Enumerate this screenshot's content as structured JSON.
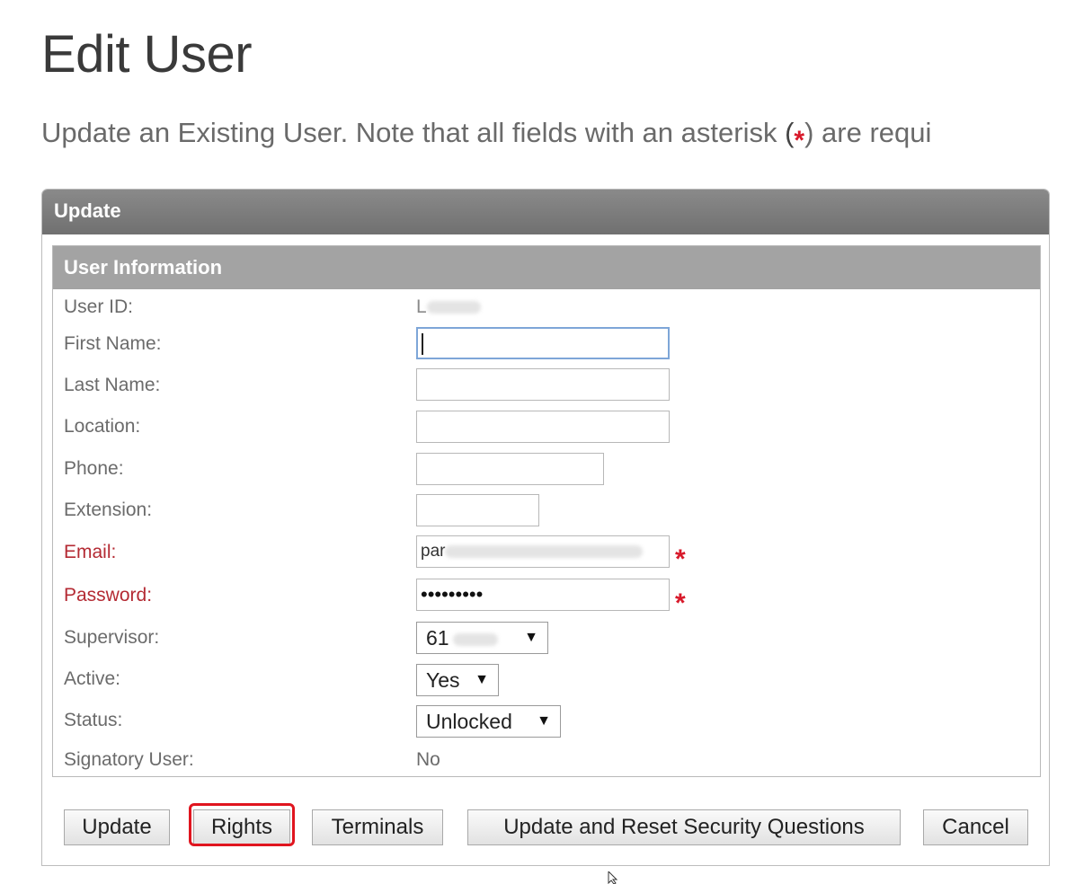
{
  "page": {
    "title": "Edit User",
    "intro_before": "Update an Existing User.  Note that all fields with an asterisk ",
    "intro_open": "(",
    "intro_asterisk": "*",
    "intro_after": ")  are requi"
  },
  "panel": {
    "title": "Update",
    "section_title": "User Information"
  },
  "fields": {
    "user_id": {
      "label": "User ID:",
      "value": "L"
    },
    "first_name": {
      "label": "First Name:",
      "value": ""
    },
    "last_name": {
      "label": "Last Name:",
      "value": ""
    },
    "location": {
      "label": "Location:",
      "value": ""
    },
    "phone": {
      "label": "Phone:",
      "value": ""
    },
    "extension": {
      "label": "Extension:",
      "value": ""
    },
    "email": {
      "label": "Email:",
      "value": "par"
    },
    "password": {
      "label": "Password:",
      "value": "•••••••••"
    },
    "supervisor": {
      "label": "Supervisor:",
      "value": "61"
    },
    "active": {
      "label": "Active:",
      "value": "Yes"
    },
    "status": {
      "label": "Status:",
      "value": "Unlocked"
    },
    "signatory": {
      "label": "Signatory User:",
      "value": "No"
    }
  },
  "required_mark": "*",
  "buttons": {
    "update": "Update",
    "rights": "Rights",
    "terminals": "Terminals",
    "update_reset": "Update and Reset Security Questions",
    "cancel": "Cancel"
  },
  "colors": {
    "required": "#b42a33",
    "asterisk": "#d8192a",
    "highlight": "#e0151f",
    "panel_header": "#7a7a7a",
    "section_header": "#a3a3a3"
  }
}
